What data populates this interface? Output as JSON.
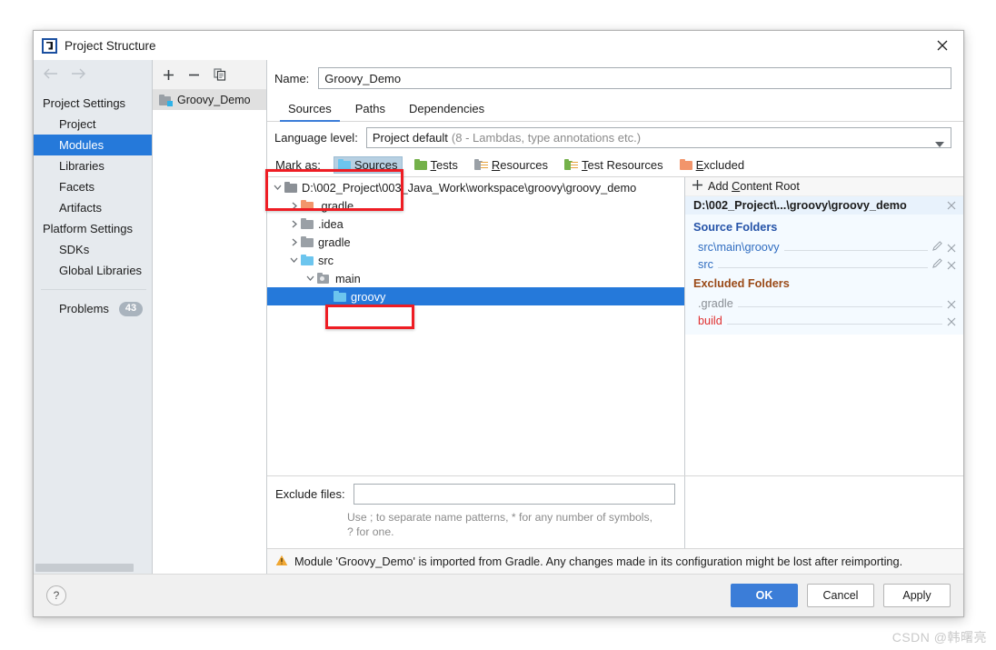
{
  "window": {
    "title": "Project Structure",
    "app_icon": "intellij-idea-icon",
    "close_icon": "close-icon"
  },
  "sidebar": {
    "back_icon": "arrow-left-icon",
    "forward_icon": "arrow-right-icon",
    "items": [
      {
        "label": "Project Settings",
        "type": "group",
        "selected": false
      },
      {
        "label": "Project",
        "type": "child",
        "selected": false
      },
      {
        "label": "Modules",
        "type": "child",
        "selected": true
      },
      {
        "label": "Libraries",
        "type": "child",
        "selected": false
      },
      {
        "label": "Facets",
        "type": "child",
        "selected": false
      },
      {
        "label": "Artifacts",
        "type": "child",
        "selected": false
      },
      {
        "label": "Platform Settings",
        "type": "group",
        "selected": false
      },
      {
        "label": "SDKs",
        "type": "child",
        "selected": false
      },
      {
        "label": "Global Libraries",
        "type": "child",
        "selected": false
      }
    ],
    "problems": {
      "label": "Problems",
      "count": "43"
    }
  },
  "modules": {
    "toolbar": {
      "add_icon": "plus-icon",
      "remove_icon": "minus-icon",
      "copy_icon": "copy-icon"
    },
    "items": [
      {
        "label": "Groovy_Demo",
        "icon": "module-icon",
        "selected": true
      }
    ]
  },
  "main": {
    "name_label": "Name:",
    "name_value": "Groovy_Demo",
    "name_placeholder": "",
    "tabs": [
      {
        "label": "Sources",
        "active": true
      },
      {
        "label": "Paths",
        "active": false
      },
      {
        "label": "Dependencies",
        "active": false
      }
    ],
    "language_level": {
      "label": "Language level:",
      "value": "Project default",
      "hint": "(8 - Lambdas, type annotations etc.)",
      "chevron_icon": "chevron-down-icon"
    },
    "mark_as": {
      "label": "Mark as:",
      "options": [
        {
          "label": "Sources",
          "mnemonic": "S",
          "rest": "ources",
          "icon": "folder-sources-icon",
          "active": true
        },
        {
          "label": "Tests",
          "mnemonic": "T",
          "rest": "ests",
          "icon": "folder-tests-icon",
          "active": false
        },
        {
          "label": "Resources",
          "mnemonic": "R",
          "rest": "esources",
          "icon": "folder-resources-icon",
          "active": false
        },
        {
          "label": "Test Resources",
          "mnemonic": "T",
          "rest": "est Resources",
          "icon": "folder-test-resources-icon",
          "active": false
        },
        {
          "label": "Excluded",
          "mnemonic": "E",
          "rest": "xcluded",
          "icon": "folder-excluded-icon",
          "active": false
        }
      ]
    },
    "tree": [
      {
        "label": "D:\\002_Project\\003_Java_Work\\workspace\\groovy\\groovy_demo",
        "indent": 0,
        "twisty": "expanded",
        "icon": "folder-gray-icon",
        "selected": false
      },
      {
        "label": ".gradle",
        "indent": 1,
        "twisty": "collapsed",
        "icon": "folder-orange-icon",
        "selected": false
      },
      {
        "label": ".idea",
        "indent": 1,
        "twisty": "collapsed",
        "icon": "folder-gray-icon",
        "selected": false
      },
      {
        "label": "gradle",
        "indent": 1,
        "twisty": "collapsed",
        "icon": "folder-gray-icon",
        "selected": false
      },
      {
        "label": "src",
        "indent": 1,
        "twisty": "expanded",
        "icon": "folder-blue-icon",
        "selected": false
      },
      {
        "label": "main",
        "indent": 2,
        "twisty": "expanded",
        "icon": "folder-module-icon",
        "selected": false
      },
      {
        "label": "groovy",
        "indent": 3,
        "twisty": "none",
        "icon": "folder-blue-icon",
        "selected": true
      }
    ],
    "exclude": {
      "label": "Exclude files:",
      "value": "",
      "placeholder": "",
      "hint_line1": "Use ; to separate name patterns, * for any number of symbols,",
      "hint_line2": "? for one."
    },
    "warning": {
      "icon": "warning-triangle-icon",
      "text": "Module 'Groovy_Demo' is imported from Gradle. Any changes made in its configuration might be lost after reimporting."
    }
  },
  "content_root": {
    "add_label": "Add Content Root",
    "add_mnemonic": "C",
    "add_icon": "plus-icon",
    "path": "D:\\002_Project\\...\\groovy\\groovy_demo",
    "remove_icon": "close-small-icon",
    "sections": [
      {
        "title": "Source Folders",
        "kind": "source",
        "folders": [
          {
            "name": "src\\main\\groovy",
            "color": "blue",
            "edit_icon": "pencil-icon",
            "remove_icon": "close-small-icon"
          },
          {
            "name": "src",
            "color": "blue",
            "edit_icon": "pencil-icon",
            "remove_icon": "close-small-icon"
          }
        ]
      },
      {
        "title": "Excluded Folders",
        "kind": "excluded",
        "folders": [
          {
            "name": ".gradle",
            "color": "gray",
            "edit_icon": "",
            "remove_icon": "close-small-icon"
          },
          {
            "name": "build",
            "color": "red",
            "edit_icon": "",
            "remove_icon": "close-small-icon"
          }
        ]
      }
    ]
  },
  "footer": {
    "help_label": "?",
    "ok_label": "OK",
    "cancel_label": "Cancel",
    "apply_label": "Apply"
  },
  "watermark": "CSDN @韩曙亮",
  "colors": {
    "accent": "#3b7dd8",
    "selection": "#2579da",
    "annotation": "#ee1d24",
    "sidebar_bg": "#e6eaee",
    "source_folder_blue": "#2553a8",
    "excluded_brown": "#9a4a18"
  }
}
